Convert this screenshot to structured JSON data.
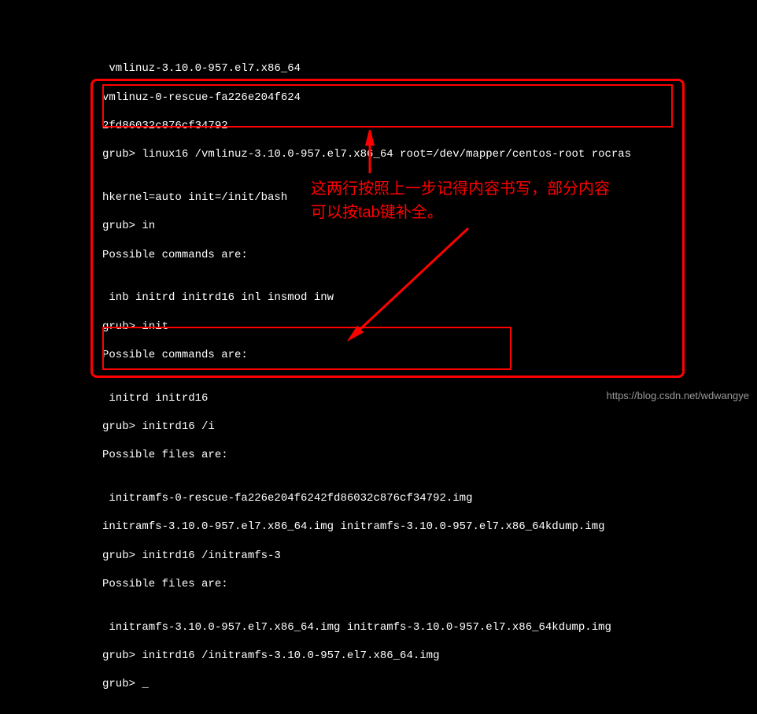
{
  "terminal": {
    "lines": [
      " vmlinuz-3.10.0-957.el7.x86_64",
      "vmlinuz-0-rescue-fa226e204f624",
      "2fd86032c876cf34792",
      "grub> linux16 /vmlinuz-3.10.0-957.el7.x86_64 root=/dev/mapper/centos-root rocras",
      "",
      "hkernel=auto init=/init/bash",
      "grub> in",
      "Possible commands are:",
      "",
      " inb initrd initrd16 inl insmod inw",
      "grub> init",
      "Possible commands are:",
      "",
      " initrd initrd16",
      "grub> initrd16 /i",
      "Possible files are:",
      "",
      " initramfs-0-rescue-fa226e204f6242fd86032c876cf34792.img",
      "initramfs-3.10.0-957.el7.x86_64.img initramfs-3.10.0-957.el7.x86_64kdump.img",
      "grub> initrd16 /initramfs-3",
      "Possible files are:",
      "",
      " initramfs-3.10.0-957.el7.x86_64.img initramfs-3.10.0-957.el7.x86_64kdump.img",
      "grub> initrd16 /initramfs-3.10.0-957.el7.x86_64.img",
      "grub> _"
    ]
  },
  "annotation": {
    "line1": "这两行按照上一步记得内容书写，部分内容",
    "line2": "可以按tab键补全。"
  },
  "watermark": "https://blog.csdn.net/wdwangye"
}
